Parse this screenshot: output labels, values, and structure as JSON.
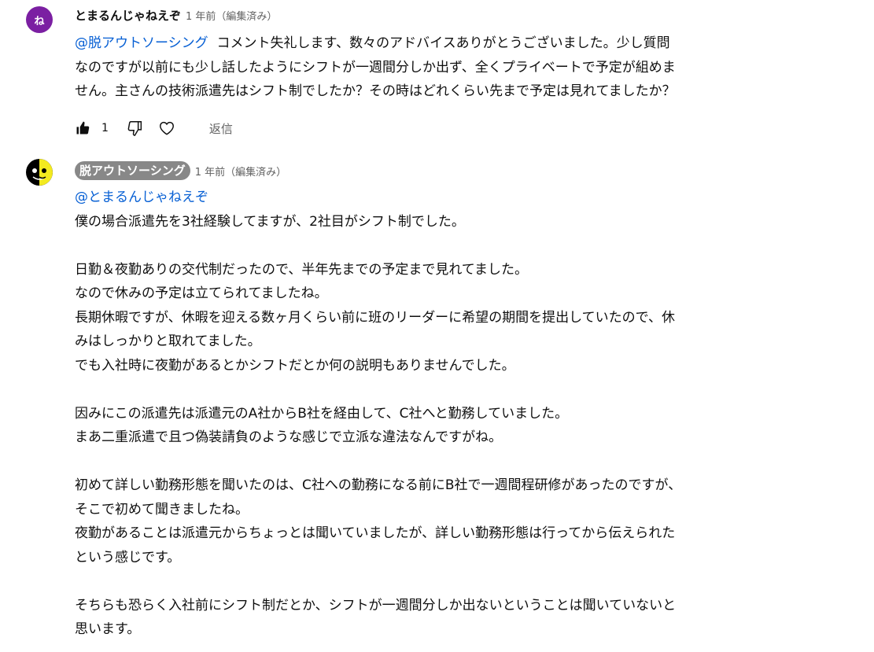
{
  "comments": [
    {
      "author": "とまるんじゃねえぞ",
      "avatar_letter": "ね",
      "meta": "1 年前（編集済み）",
      "mention": "@脱アウトソーシング",
      "body": "コメント失礼します、数々のアドバイスありがとうございました。少し質問\nなのですが以前にも少し話したようにシフトが一週間分しか出ず、全くプライベートで予定が組めま\nせん。主さんの技術派遣先はシフト制でしたか？その時はどれくらい先まで予定は見れてましたか？",
      "likes": "1",
      "reply_label": "返信"
    },
    {
      "author": "脱アウトソーシング",
      "meta": "1 年前（編集済み）",
      "mention": "@とまるんじゃねえぞ",
      "body": "僕の場合派遣先を3社経験してますが、2社目がシフト制でした。\n\n日勤＆夜勤ありの交代制だったので、半年先までの予定まで見れてました。\nなので休みの予定は立てられてましたね。\n長期休暇ですが、休暇を迎える数ヶ月くらい前に班のリーダーに希望の期間を提出していたので、休\nみはしっかりと取れてました。\nでも入社時に夜勤があるとかシフトだとか何の説明もありませんでした。\n\n因みにこの派遣先は派遣元のA社からB社を経由して、C社へと勤務していました。\nまあ二重派遣で且つ偽装請負のような感じで立派な違法なんですがね。\n\n初めて詳しい勤務形態を聞いたのは、C社への勤務になる前にB社で一週間程研修があったのですが、\nそこで初めて聞きましたね。\n夜勤があることは派遣元からちょっとは聞いていましたが、詳しい勤務形態は行ってから伝えられた\nという感じです。\n\nそちらも恐らく入社前にシフト制だとか、シフトが一週間分しか出ないということは聞いていないと\n思います。"
    }
  ],
  "icons": {
    "like": "thumbs-up-icon",
    "dislike": "thumbs-down-icon",
    "heart": "heart-icon"
  },
  "colors": {
    "mention": "#065fd4",
    "avatar1": "#7b1fa2",
    "author_chip": "#888888",
    "meta": "#606060"
  }
}
